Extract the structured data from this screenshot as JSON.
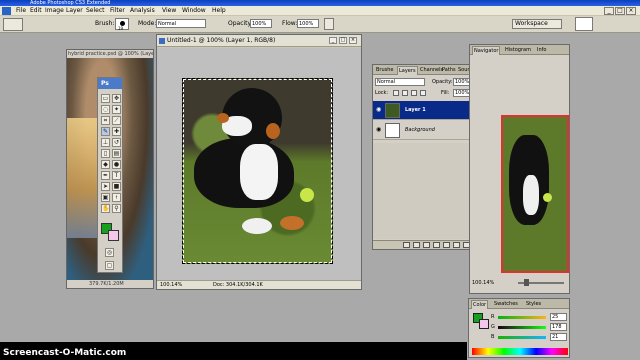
{
  "window": {
    "title": "Adobe Photoshop CS3 Extended"
  },
  "menu": {
    "items": [
      "File",
      "Edit",
      "Image",
      "Layer",
      "Select",
      "Filter",
      "Analysis",
      "View",
      "Window",
      "Help"
    ],
    "min": "_",
    "max": "□",
    "close": "×"
  },
  "options": {
    "brush_label": "Brush:",
    "brush_size": "19",
    "mode_label": "Mode:",
    "mode_value": "Normal",
    "opacity_label": "Opacity:",
    "opacity_value": "100%",
    "flow_label": "Flow:",
    "flow_value": "100%",
    "workspace_label": "Workspace"
  },
  "hybrid_doc": {
    "title": "hybrid practice.psd @ 100% (Layer",
    "status": "379.7K/1.20M"
  },
  "tools": {
    "header": "Ps",
    "fg_color": "#16a01e",
    "bg_color": "#f3c8ec",
    "text_tool": "T"
  },
  "main_doc": {
    "title": "Untitled-1 @ 100% (Layer 1, RGB/8)",
    "zoom": "100.14%",
    "doc_size": "Doc: 304.1K/304.1K"
  },
  "layers_panel": {
    "tabs": [
      "Brushe",
      "Layers",
      "Channels",
      "Paths",
      "Source"
    ],
    "blend_mode": "Normal",
    "opacity_label": "Opacity:",
    "opacity_value": "100%",
    "lock_label": "Lock:",
    "fill_label": "Fill:",
    "fill_value": "100%",
    "layers": [
      {
        "name": "Layer 1",
        "active": true
      },
      {
        "name": "Background",
        "active": false,
        "locked": true
      }
    ]
  },
  "navigator_panel": {
    "tabs": [
      "Navigator",
      "Histogram",
      "Info"
    ],
    "zoom": "100.14%"
  },
  "color_panel": {
    "tabs": [
      "Color",
      "Swatches",
      "Styles"
    ],
    "channels": [
      {
        "name": "R",
        "value": "25"
      },
      {
        "name": "G",
        "value": "178"
      },
      {
        "name": "B",
        "value": "21"
      }
    ]
  },
  "watermark": "Screencast-O-Matic.com"
}
